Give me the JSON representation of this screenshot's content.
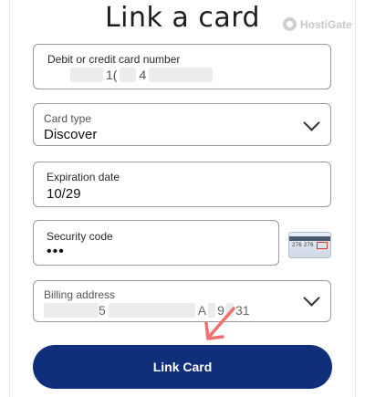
{
  "title": "Link a card",
  "watermark": "HostiGate",
  "card_number": {
    "label": "Debit or credit card number",
    "visible_fragments": [
      "1(",
      "4"
    ]
  },
  "card_type": {
    "label": "Card type",
    "value": "Discover"
  },
  "expiration": {
    "label": "Expiration date",
    "value": "10/29"
  },
  "security_code": {
    "label": "Security code",
    "value": "•••"
  },
  "cvv_illustration": {
    "digits": "276 276",
    "code": "337"
  },
  "billing_address": {
    "label": "Billing address",
    "visible_fragments": [
      "5",
      "A",
      "9",
      "31"
    ]
  },
  "button": {
    "label": "Link Card"
  },
  "colors": {
    "button_bg": "#0f2f7a",
    "arrow": "#f07070",
    "border": "#9a9a9a"
  },
  "icons": {
    "dropdown": "chevron-down-icon",
    "cvv": "credit-card-back-icon",
    "annotation": "arrow-icon"
  }
}
